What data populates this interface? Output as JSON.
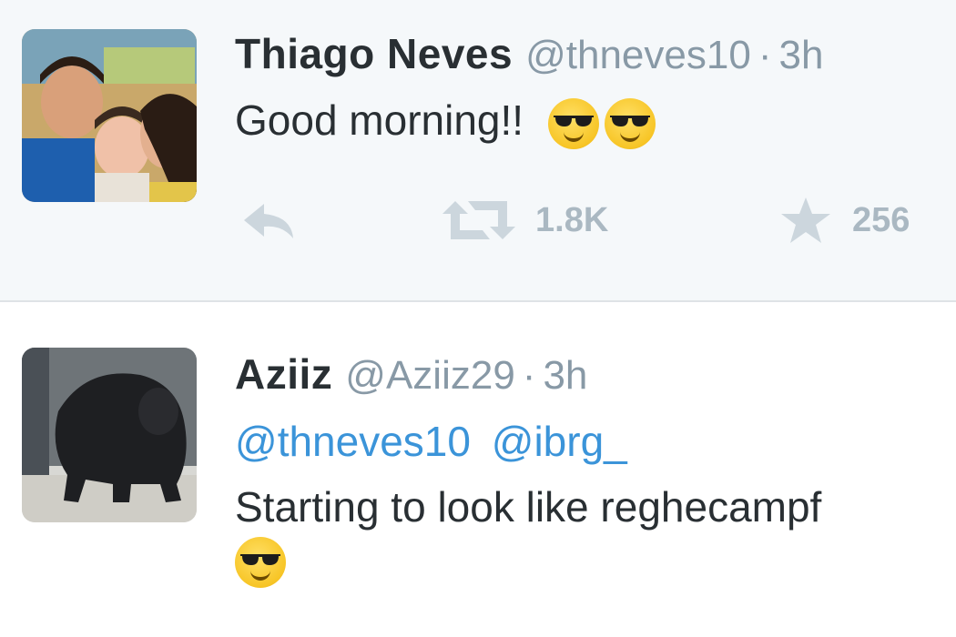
{
  "tweets": [
    {
      "name": "Thiago Neves",
      "handle": "@thneves10",
      "separator": "·",
      "time": "3h",
      "text": "Good morning!!",
      "emojis": [
        "smiling-face-with-sunglasses",
        "smiling-face-with-sunglasses"
      ],
      "retweet_count": "1.8K",
      "favorite_count": "256"
    },
    {
      "name": "Aziiz",
      "handle": "@Aziiz29",
      "separator": "·",
      "time": "3h",
      "mentions": [
        "@thneves10",
        "@ibrg_"
      ],
      "text": "Starting to look like reghecampf",
      "emojis": [
        "smiling-face-with-sunglasses"
      ]
    }
  ],
  "colors": {
    "background_highlight": "#f5f8fa",
    "link": "#3b94d9",
    "muted": "#8899a6",
    "action_icon": "#ccd6dd"
  }
}
